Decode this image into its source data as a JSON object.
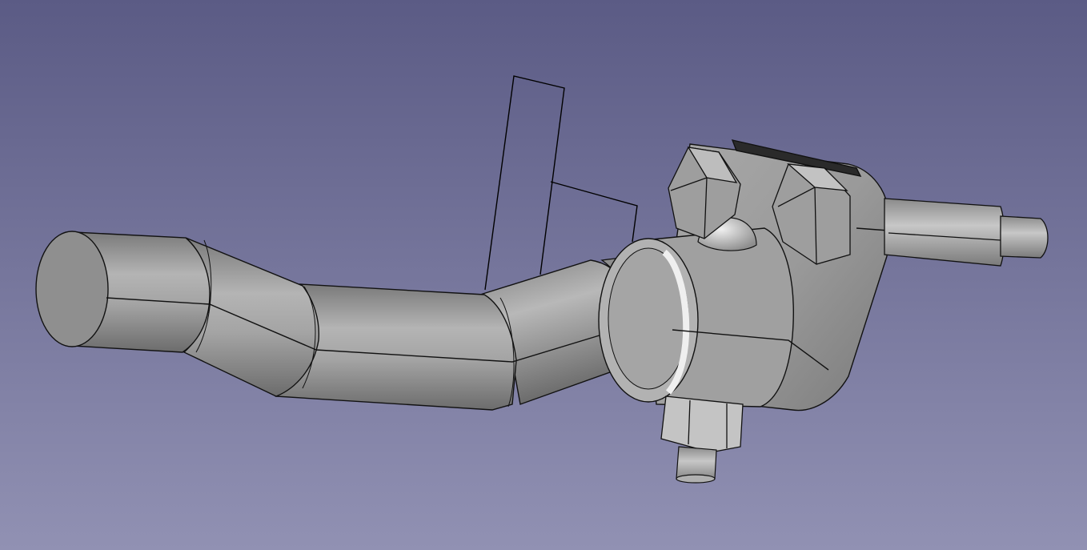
{
  "viewport": {
    "background_top": "#5b5b85",
    "background_bottom": "#9191b3",
    "view_mode": "3D view"
  },
  "model": {
    "description_icon": "3d-part-icon",
    "part_fill": "#9a9a9a",
    "part_light": "#cfcfcf",
    "part_dark": "#5f5f5f",
    "edge_color": "#111111",
    "sketch_line_color": "#000000"
  }
}
